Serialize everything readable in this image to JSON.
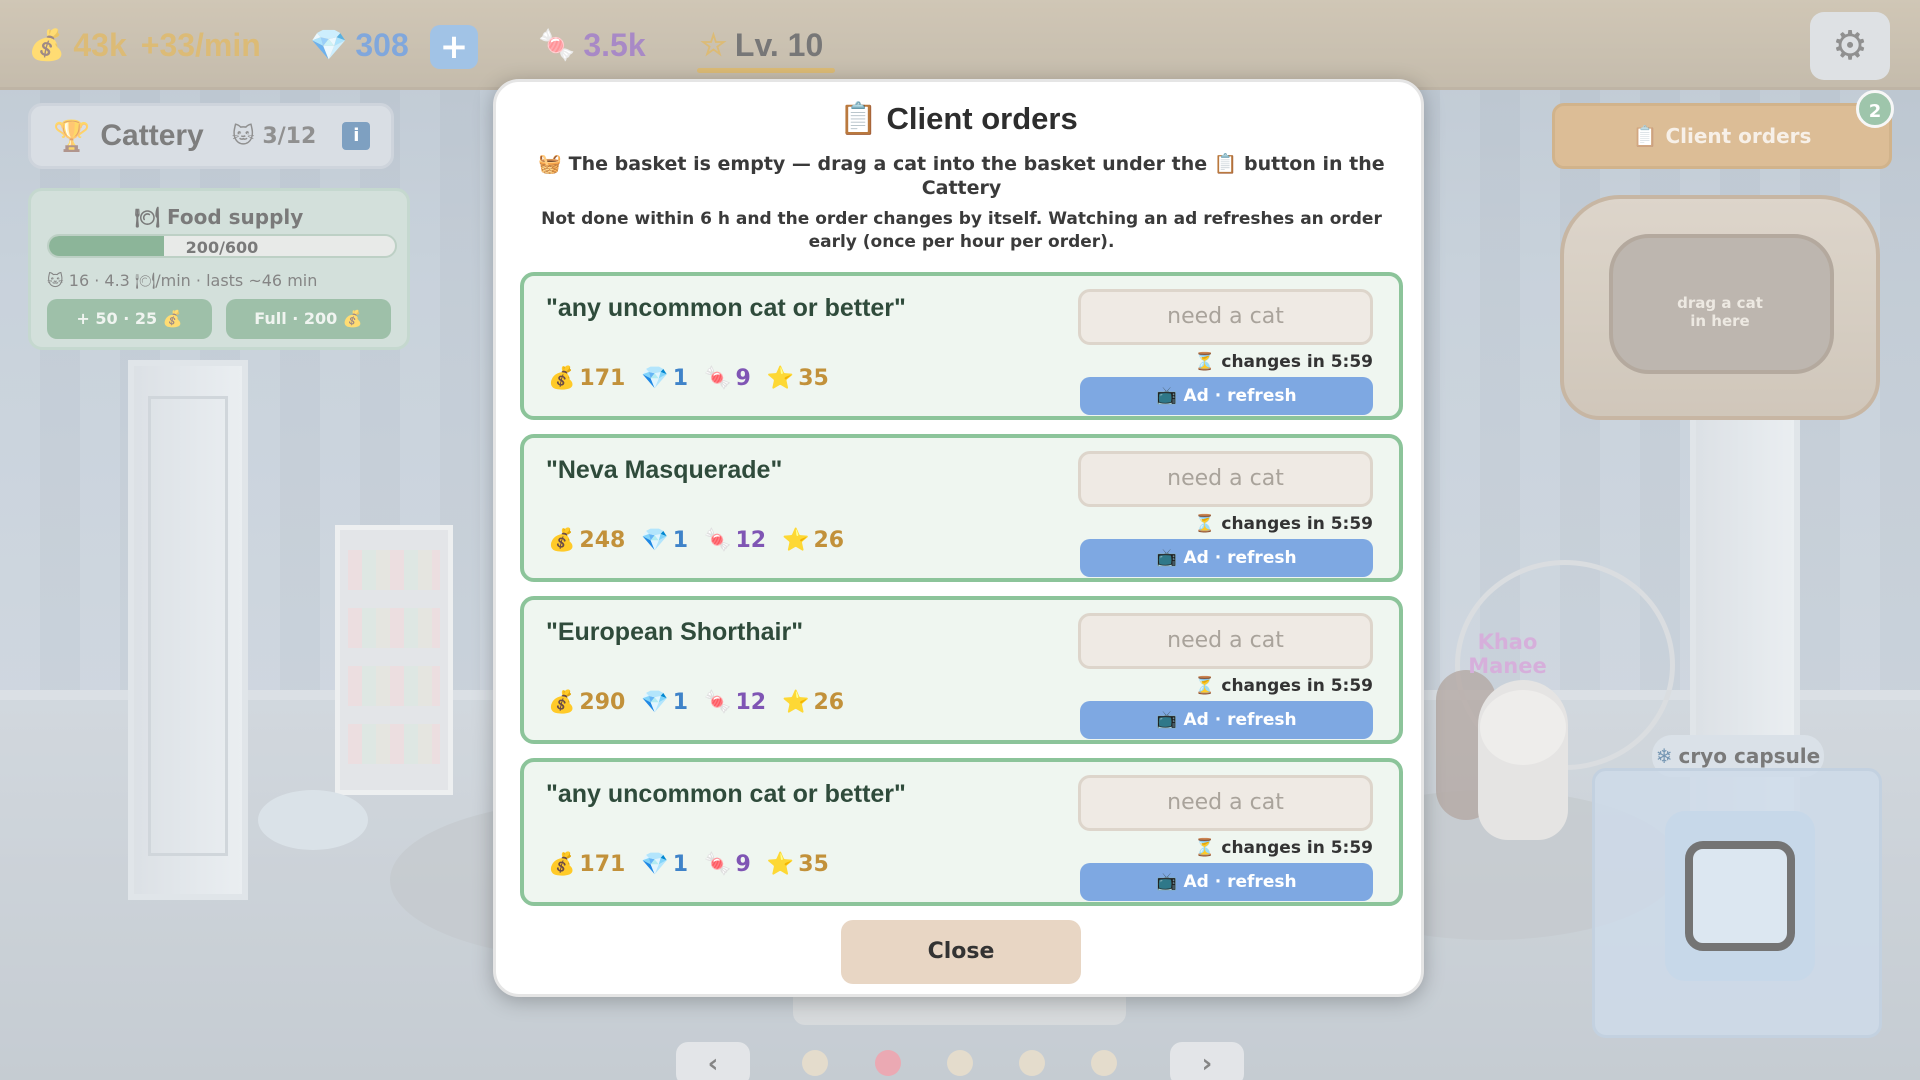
{
  "topbar": {
    "coins": "43k",
    "coin_rate": "+33/min",
    "gems": "308",
    "plus_label": "+",
    "candy": "3.5k",
    "level": "Lv. 10"
  },
  "cattery": {
    "title": "Cattery",
    "count": "3/12",
    "info_label": "i"
  },
  "food": {
    "title": "Food supply",
    "amount_text": "200/600",
    "fill_fraction": 0.333,
    "sub": "16 · 4.3 🍽/min · lasts ~46 min",
    "buttons": {
      "plus": "+ 50 · 25",
      "full": "Full · 200"
    }
  },
  "right": {
    "orders_label": "Client orders",
    "orders_badge": "2",
    "basket_text": "drag a cat\nin here",
    "cat_name": "Khao\nManee",
    "cryo_label": "cryo capsule"
  },
  "modal": {
    "title": "Client orders",
    "warn": "The basket is empty — drag a cat into the basket under the 📋 button in the Cattery",
    "note": "Not done within 6 h and the order changes by itself. Watching an ad refreshes an order early (once per hour per order).",
    "orders": [
      {
        "query": "\"any uncommon cat or better\"",
        "coins": "171",
        "gems": "1",
        "candy": "9",
        "stars": "35",
        "slot": "need a cat",
        "timer": "changes in 5:59",
        "ad": "Ad · refresh"
      },
      {
        "query": "\"Neva Masquerade\"",
        "coins": "248",
        "gems": "1",
        "candy": "12",
        "stars": "26",
        "slot": "need a cat",
        "timer": "changes in 5:59",
        "ad": "Ad · refresh"
      },
      {
        "query": "\"European Shorthair\"",
        "coins": "290",
        "gems": "1",
        "candy": "12",
        "stars": "26",
        "slot": "need a cat",
        "timer": "changes in 5:59",
        "ad": "Ad · refresh"
      },
      {
        "query": "\"any uncommon cat or better\"",
        "coins": "171",
        "gems": "1",
        "candy": "9",
        "stars": "35",
        "slot": "need a cat",
        "timer": "changes in 5:59",
        "ad": "Ad · refresh"
      }
    ],
    "close_label": "Close"
  },
  "nav": {
    "prev": "‹",
    "next": "›"
  },
  "icons": {
    "coin": "coin-icon",
    "gem": "gem-icon",
    "candy": "candy-icon",
    "star": "star-icon",
    "clipboard": "clipboard-icon",
    "hourglass": "hourglass-icon",
    "tv": "tv-icon",
    "trophy": "trophy-icon",
    "cat": "cat-icon",
    "gear": "gear-icon",
    "snowflake": "snowflake-icon",
    "basket": "basket-icon",
    "plate": "plate-icon"
  }
}
